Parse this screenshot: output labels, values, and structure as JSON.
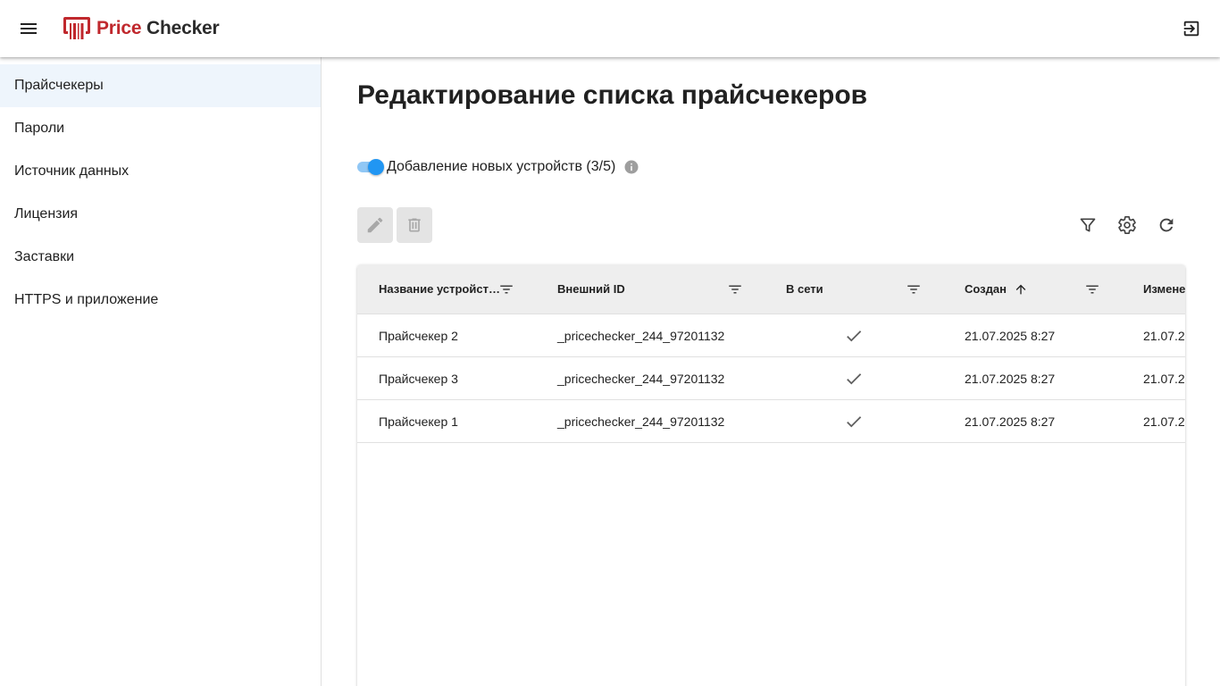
{
  "header": {
    "logo_price": "Price",
    "logo_checker": "Checker"
  },
  "sidebar": {
    "items": [
      {
        "label": "Прайсчекеры",
        "active": true
      },
      {
        "label": "Пароли"
      },
      {
        "label": "Источник данных"
      },
      {
        "label": "Лицензия"
      },
      {
        "label": "Заставки"
      },
      {
        "label": "HTTPS и приложение"
      }
    ]
  },
  "main": {
    "title": "Редактирование списка прайсчекеров",
    "toggle_label": "Добавление новых устройств (3/5)",
    "toggle_on": true
  },
  "table": {
    "columns": [
      {
        "label": "Название устройст…"
      },
      {
        "label": "Внешний ID"
      },
      {
        "label": "В сети"
      },
      {
        "label": "Создан",
        "sort": "asc"
      },
      {
        "label": "Измене"
      }
    ],
    "rows": [
      {
        "name": "Прайсчекер 2",
        "external_id": "_pricechecker_244_97201132",
        "online": true,
        "created": "21.07.2025 8:27",
        "modified": "21.07.2"
      },
      {
        "name": "Прайсчекер 3",
        "external_id": "_pricechecker_244_97201132",
        "online": true,
        "created": "21.07.2025 8:27",
        "modified": "21.07.2"
      },
      {
        "name": "Прайсчекер 1",
        "external_id": "_pricechecker_244_97201132",
        "online": true,
        "created": "21.07.2025 8:27",
        "modified": "21.07.2"
      }
    ]
  },
  "colors": {
    "brand_red": "#c0282d",
    "accent_blue": "#2196f3",
    "active_nav_bg": "#eef5fc"
  },
  "icons": {
    "menu": "menu-icon",
    "logo": "price-checker-logo-icon",
    "logout": "logout-icon",
    "info": "info-icon",
    "edit": "pencil-icon",
    "delete": "trash-icon",
    "filter": "funnel-icon",
    "settings": "gear-icon",
    "refresh": "refresh-icon",
    "column_filter": "filter-lines-icon",
    "sort": "arrow-up-icon",
    "online": "check-icon"
  }
}
